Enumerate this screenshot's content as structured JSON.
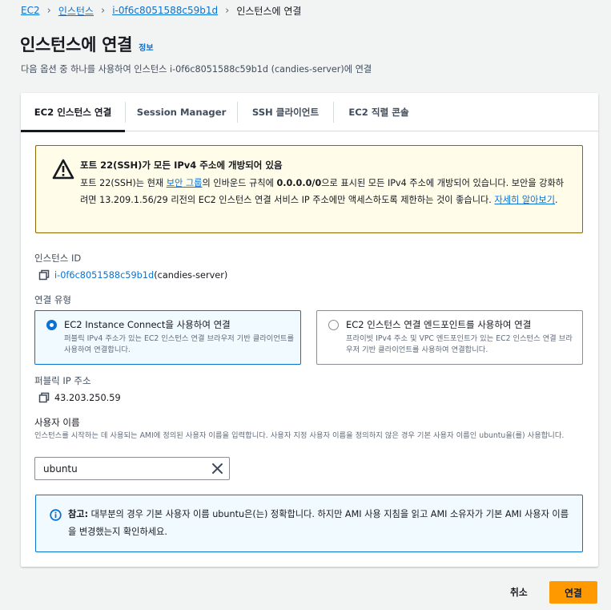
{
  "breadcrumb": {
    "items": [
      "EC2",
      "인스턴스",
      "i-0f6c8051588c59b1d"
    ],
    "current": "인스턴스에 연결"
  },
  "page": {
    "title": "인스턴스에 연결",
    "info_link": "정보",
    "description": "다음 옵션 중 하나를 사용하여 인스턴스 i-0f6c8051588c59b1d (candies-server)에 연결"
  },
  "tabs": [
    "EC2 인스턴스 연결",
    "Session Manager",
    "SSH 클라이언트",
    "EC2 직렬 콘솔"
  ],
  "warning": {
    "title": "포트 22(SSH)가 모든 IPv4 주소에 개방되어 있음",
    "text_1": "포트 22(SSH)는 현재 ",
    "link_security_group": "보안 그룹",
    "text_2": "의 인바운드 규칙에 ",
    "cidr": "0.0.0.0/0",
    "text_3": "으로 표시된 모든 IPv4 주소에 개방되어 있습니다. 보안을 강화하려면 13.209.1.56/29 리전의 EC2 인스턴스 연결 서비스 IP 주소에만 액세스하도록 제한하는 것이 좋습니다. ",
    "link_learn_more": "자세히 알아보기",
    "text_4": "."
  },
  "instance": {
    "label": "인스턴스 ID",
    "id": "i-0f6c8051588c59b1d",
    "name": " (candies-server)"
  },
  "connection_type": {
    "label": "연결 유형",
    "options": [
      {
        "title": "EC2 Instance Connect을 사용하여 연결",
        "desc": "퍼블릭 IPv4 주소가 있는 EC2 인스턴스 연결 브라우저 기반 클라이언트를 사용하여 연결합니다.",
        "selected": true
      },
      {
        "title": "EC2 인스턴스 연결 엔드포인트를 사용하여 연결",
        "desc": "프라이빗 IPv4 주소 및 VPC 엔드포인트가 있는 EC2 인스턴스 연결 브라우저 기반 클라이언트를 사용하여 연결합니다.",
        "selected": false
      }
    ]
  },
  "public_ip": {
    "label": "퍼블릭 IP 주소",
    "value": "43.203.250.59"
  },
  "username": {
    "label": "사용자 이름",
    "description": "인스턴스를 시작하는 데 사용되는 AMI에 정의된 사용자 이름을 입력합니다. 사용자 지정 사용자 이름을 정의하지 않은 경우 기본 사용자 이름인 ubuntu을(를) 사용합니다.",
    "value": "ubuntu"
  },
  "note": {
    "bold": "참고:",
    "text": " 대부분의 경우 기본 사용자 이름 ubuntu은(는) 정확합니다. 하지만 AMI 사용 지침을 읽고 AMI 소유자가 기본 AMI 사용자 이름을 변경했는지 확인하세요."
  },
  "actions": {
    "cancel": "취소",
    "connect": "연결"
  },
  "colors": {
    "link": "#0972d3",
    "primary_button": "#ff9900",
    "warning_bg": "#fffce9",
    "warning_border": "#8d6605",
    "info_bg": "#f1faff"
  },
  "icons": [
    "warning-icon",
    "copy-icon",
    "clear-icon",
    "info-icon",
    "chevron-right-icon"
  ]
}
